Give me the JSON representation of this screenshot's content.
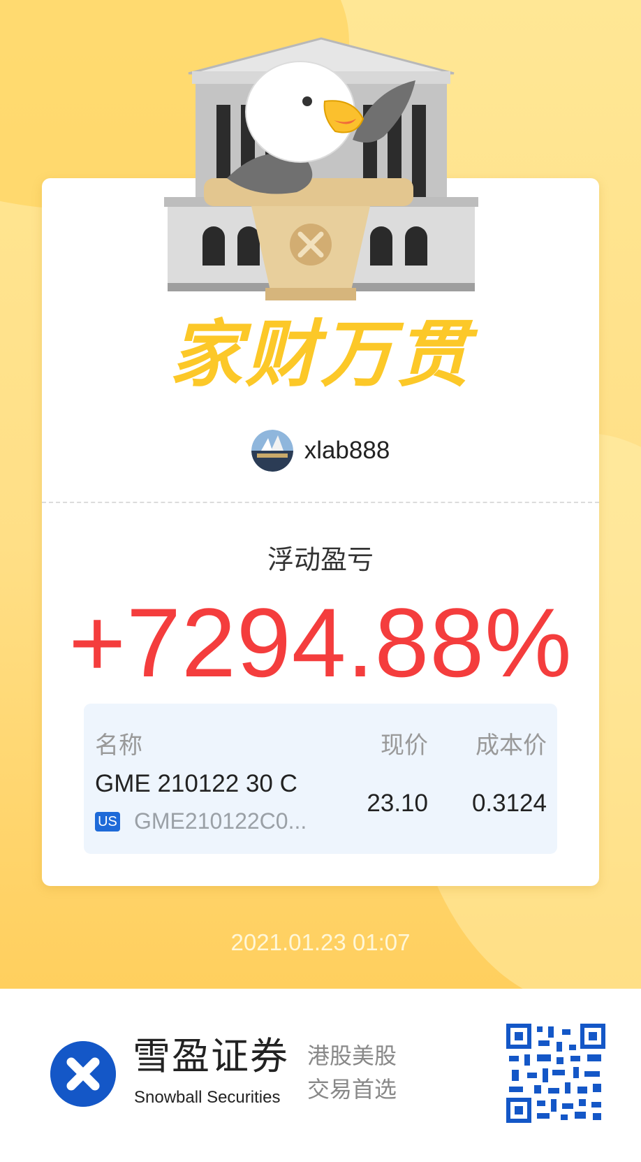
{
  "slogan": "家财万贯",
  "user": {
    "name": "xlab888"
  },
  "floating_pl": {
    "label": "浮动盈亏",
    "value": "+7294.88%"
  },
  "position": {
    "headers": {
      "name": "名称",
      "price": "现价",
      "cost": "成本价"
    },
    "symbol": "GME 210122 30 C",
    "market": "US",
    "code": "GME210122C0...",
    "price": "23.10",
    "cost": "0.3124"
  },
  "timestamp": "2021.01.23 01:07",
  "footer": {
    "brand_cn": "雪盈证券",
    "brand_en": "Snowball Securities",
    "tagline_line1": "港股美股",
    "tagline_line2": "交易首选"
  },
  "colors": {
    "gain": "#f43d3d",
    "slogan": "#fcc828",
    "brand": "#1457c7",
    "background": "#ffdf86"
  }
}
